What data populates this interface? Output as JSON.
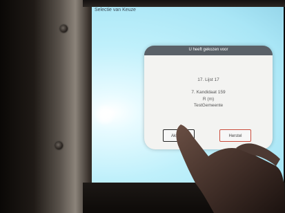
{
  "window": {
    "title": "Selectie van Keuze"
  },
  "dialog": {
    "title": "U heeft gekozen voor",
    "list": "17. Lijst 17",
    "candidate": "7. Kandidaat 159",
    "gender": "R (m)",
    "municipality": "TestGemeente",
    "ok_label": "Akkoord",
    "cancel_label": "Herstel"
  },
  "colors": {
    "screen": "#bff0fb",
    "dialog_bg": "#f3f3f1",
    "dialog_header": "#5a6168",
    "cancel_border": "#c94a3a"
  }
}
